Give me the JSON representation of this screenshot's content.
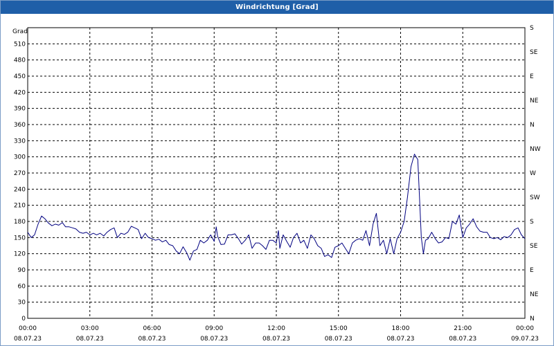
{
  "window": {
    "title": "Windrichtung [Grad]"
  },
  "chart_data": {
    "type": "line",
    "title": "Windrichtung [Grad]",
    "ylabel": "Grad",
    "ylim": [
      0,
      540
    ],
    "yticks": [
      0,
      30,
      60,
      90,
      120,
      150,
      180,
      210,
      240,
      270,
      300,
      330,
      360,
      390,
      420,
      450,
      480,
      510
    ],
    "ytick_labels": [
      "0",
      "30",
      "60",
      "90",
      "120",
      "150",
      "180",
      "210",
      "240",
      "270",
      "300",
      "330",
      "360",
      "390",
      "420",
      "450",
      "480",
      "510"
    ],
    "right_tick_labels": [
      "N",
      "NE",
      "E",
      "SE",
      "S",
      "SW",
      "W",
      "NW",
      "N",
      "NE",
      "E",
      "SE",
      "S"
    ],
    "xlim": [
      0,
      24
    ],
    "xticks": [
      0,
      3,
      6,
      9,
      12,
      15,
      18,
      21,
      24
    ],
    "xtick_time_labels": [
      "00:00",
      "03:00",
      "06:00",
      "09:00",
      "12:00",
      "15:00",
      "18:00",
      "21:00",
      "00:00"
    ],
    "xtick_date_labels": [
      "08.07.23",
      "08.07.23",
      "08.07.23",
      "08.07.23",
      "08.07.23",
      "08.07.23",
      "08.07.23",
      "08.07.23",
      "09.07.23"
    ],
    "grid": true,
    "series": [
      {
        "color": "#000080",
        "x_unit": "hours",
        "values": [
          [
            0.0,
            160
          ],
          [
            0.17,
            150
          ],
          [
            0.33,
            155
          ],
          [
            0.5,
            175
          ],
          [
            0.67,
            190
          ],
          [
            0.83,
            185
          ],
          [
            1.0,
            177
          ],
          [
            1.17,
            172
          ],
          [
            1.33,
            175
          ],
          [
            1.5,
            173
          ],
          [
            1.67,
            178
          ],
          [
            1.83,
            170
          ],
          [
            2.0,
            170
          ],
          [
            2.17,
            168
          ],
          [
            2.33,
            166
          ],
          [
            2.5,
            160
          ],
          [
            2.67,
            158
          ],
          [
            2.83,
            160
          ],
          [
            3.0,
            155
          ],
          [
            3.17,
            158
          ],
          [
            3.33,
            155
          ],
          [
            3.5,
            158
          ],
          [
            3.67,
            153
          ],
          [
            3.83,
            160
          ],
          [
            4.0,
            165
          ],
          [
            4.17,
            168
          ],
          [
            4.33,
            150
          ],
          [
            4.5,
            158
          ],
          [
            4.67,
            156
          ],
          [
            4.83,
            160
          ],
          [
            5.0,
            171
          ],
          [
            5.17,
            168
          ],
          [
            5.33,
            165
          ],
          [
            5.5,
            148
          ],
          [
            5.67,
            158
          ],
          [
            5.83,
            150
          ],
          [
            6.0,
            148
          ],
          [
            6.17,
            145
          ],
          [
            6.33,
            147
          ],
          [
            6.5,
            142
          ],
          [
            6.67,
            145
          ],
          [
            6.83,
            137
          ],
          [
            7.0,
            135
          ],
          [
            7.17,
            125
          ],
          [
            7.33,
            120
          ],
          [
            7.5,
            133
          ],
          [
            7.67,
            122
          ],
          [
            7.83,
            108
          ],
          [
            8.0,
            125
          ],
          [
            8.17,
            128
          ],
          [
            8.33,
            145
          ],
          [
            8.5,
            140
          ],
          [
            8.67,
            145
          ],
          [
            8.83,
            155
          ],
          [
            9.0,
            143
          ],
          [
            9.1,
            170
          ],
          [
            9.17,
            152
          ],
          [
            9.33,
            137
          ],
          [
            9.5,
            138
          ],
          [
            9.67,
            155
          ],
          [
            9.83,
            155
          ],
          [
            10.0,
            157
          ],
          [
            10.17,
            148
          ],
          [
            10.33,
            138
          ],
          [
            10.5,
            145
          ],
          [
            10.67,
            155
          ],
          [
            10.83,
            130
          ],
          [
            11.0,
            140
          ],
          [
            11.17,
            140
          ],
          [
            11.33,
            135
          ],
          [
            11.5,
            128
          ],
          [
            11.67,
            145
          ],
          [
            11.83,
            145
          ],
          [
            12.0,
            140
          ],
          [
            12.1,
            163
          ],
          [
            12.17,
            130
          ],
          [
            12.33,
            155
          ],
          [
            12.5,
            143
          ],
          [
            12.67,
            132
          ],
          [
            12.83,
            150
          ],
          [
            13.0,
            158
          ],
          [
            13.17,
            140
          ],
          [
            13.33,
            145
          ],
          [
            13.5,
            130
          ],
          [
            13.67,
            155
          ],
          [
            13.83,
            148
          ],
          [
            14.0,
            135
          ],
          [
            14.17,
            130
          ],
          [
            14.33,
            115
          ],
          [
            14.5,
            118
          ],
          [
            14.67,
            113
          ],
          [
            14.83,
            132
          ],
          [
            15.0,
            135
          ],
          [
            15.17,
            140
          ],
          [
            15.33,
            130
          ],
          [
            15.5,
            120
          ],
          [
            15.67,
            140
          ],
          [
            15.83,
            145
          ],
          [
            16.0,
            148
          ],
          [
            16.17,
            145
          ],
          [
            16.33,
            163
          ],
          [
            16.5,
            135
          ],
          [
            16.67,
            175
          ],
          [
            16.83,
            195
          ],
          [
            17.0,
            135
          ],
          [
            17.17,
            145
          ],
          [
            17.33,
            120
          ],
          [
            17.5,
            148
          ],
          [
            17.67,
            120
          ],
          [
            17.83,
            148
          ],
          [
            18.0,
            160
          ],
          [
            18.17,
            180
          ],
          [
            18.33,
            225
          ],
          [
            18.5,
            282
          ],
          [
            18.67,
            305
          ],
          [
            18.83,
            295
          ],
          [
            19.0,
            150
          ],
          [
            19.1,
            120
          ],
          [
            19.2,
            145
          ],
          [
            19.33,
            148
          ],
          [
            19.5,
            160
          ],
          [
            19.67,
            148
          ],
          [
            19.83,
            140
          ],
          [
            20.0,
            142
          ],
          [
            20.17,
            150
          ],
          [
            20.33,
            148
          ],
          [
            20.5,
            180
          ],
          [
            20.67,
            175
          ],
          [
            20.83,
            192
          ],
          [
            21.0,
            150
          ],
          [
            21.17,
            168
          ],
          [
            21.33,
            175
          ],
          [
            21.5,
            185
          ],
          [
            21.67,
            170
          ],
          [
            21.83,
            162
          ],
          [
            22.0,
            160
          ],
          [
            22.17,
            160
          ],
          [
            22.33,
            150
          ],
          [
            22.5,
            148
          ],
          [
            22.67,
            150
          ],
          [
            22.83,
            146
          ],
          [
            23.0,
            152
          ],
          [
            23.17,
            150
          ],
          [
            23.33,
            155
          ],
          [
            23.5,
            165
          ],
          [
            23.67,
            168
          ],
          [
            23.83,
            155
          ],
          [
            24.0,
            148
          ]
        ]
      }
    ]
  }
}
